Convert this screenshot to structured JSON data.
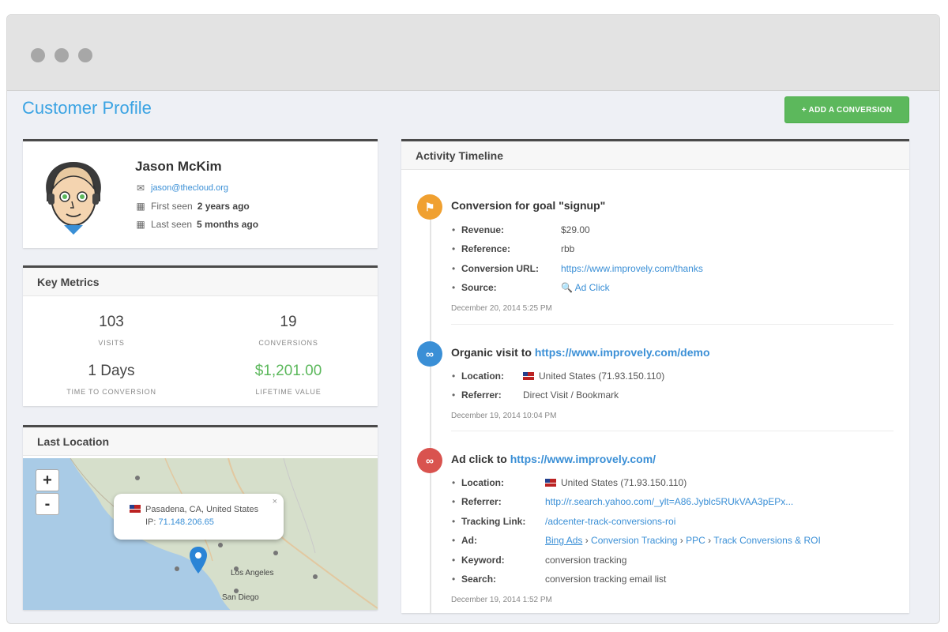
{
  "page": {
    "title": "Customer Profile",
    "add_button": "+ ADD A CONVERSION"
  },
  "profile": {
    "name": "Jason McKim",
    "email": "jason@thecloud.org",
    "first_seen_prefix": "First seen",
    "first_seen_value": "2 years ago",
    "last_seen_prefix": "Last seen",
    "last_seen_value": "5 months ago"
  },
  "metrics": {
    "title": "Key Metrics",
    "visits_value": "103",
    "visits_label": "VISITS",
    "conversions_value": "19",
    "conversions_label": "CONVERSIONS",
    "ttc_value": "1 Days",
    "ttc_label": "TIME TO CONVERSION",
    "ltv_value": "$1,201.00",
    "ltv_label": "LIFETIME VALUE"
  },
  "location": {
    "title": "Last Location",
    "zoom_in": "+",
    "zoom_out": "-",
    "popup_city": "Pasadena, CA, United States",
    "popup_ip_label": "IP:",
    "popup_ip": "71.148.206.65",
    "popup_close": "×",
    "map_labels": {
      "los_angeles": "Los Angeles",
      "san_diego": "San Diego"
    }
  },
  "timeline": {
    "title": "Activity Timeline",
    "events": [
      {
        "title": "Conversion for goal \"signup\"",
        "rows": [
          {
            "k": "Revenue:",
            "v": "$29.00"
          },
          {
            "k": "Reference:",
            "v": "rbb"
          },
          {
            "k": "Conversion URL:",
            "v": "https://www.improvely.com/thanks"
          },
          {
            "k": "Source:",
            "v": "Ad Click"
          }
        ],
        "date": "December 20, 2014 5:25 PM"
      },
      {
        "title_prefix": "Organic visit to",
        "title_link": "https://www.improvely.com/demo",
        "rows": [
          {
            "k": "Location:",
            "v": "United States (71.93.150.110)"
          },
          {
            "k": "Referrer:",
            "v": "Direct Visit / Bookmark"
          }
        ],
        "date": "December 19, 2014 10:04 PM"
      },
      {
        "title_prefix": "Ad click to",
        "title_link": "https://www.improvely.com/",
        "rows": [
          {
            "k": "Location:",
            "v": "United States (71.93.150.110)"
          },
          {
            "k": "Referrer:",
            "v": "http://r.search.yahoo.com/_ylt=A86.Jyblc5RUkVAA3pEPx..."
          },
          {
            "k": "Tracking Link:",
            "v": "/adcenter-track-conversions-roi"
          },
          {
            "k": "Ad:",
            "v1": "Bing Ads",
            "v2": "Conversion Tracking",
            "v3": "PPC",
            "v4": "Track Conversions & ROI"
          },
          {
            "k": "Keyword:",
            "v": "conversion tracking"
          },
          {
            "k": "Search:",
            "v": "conversion tracking email list"
          }
        ],
        "date": "December 19, 2014 1:52 PM"
      }
    ]
  },
  "colors": {
    "accent": "#3aa3e3",
    "green": "#5cb85c",
    "orange": "#f0a030",
    "blue": "#3a8fd6",
    "red": "#d9534f"
  }
}
